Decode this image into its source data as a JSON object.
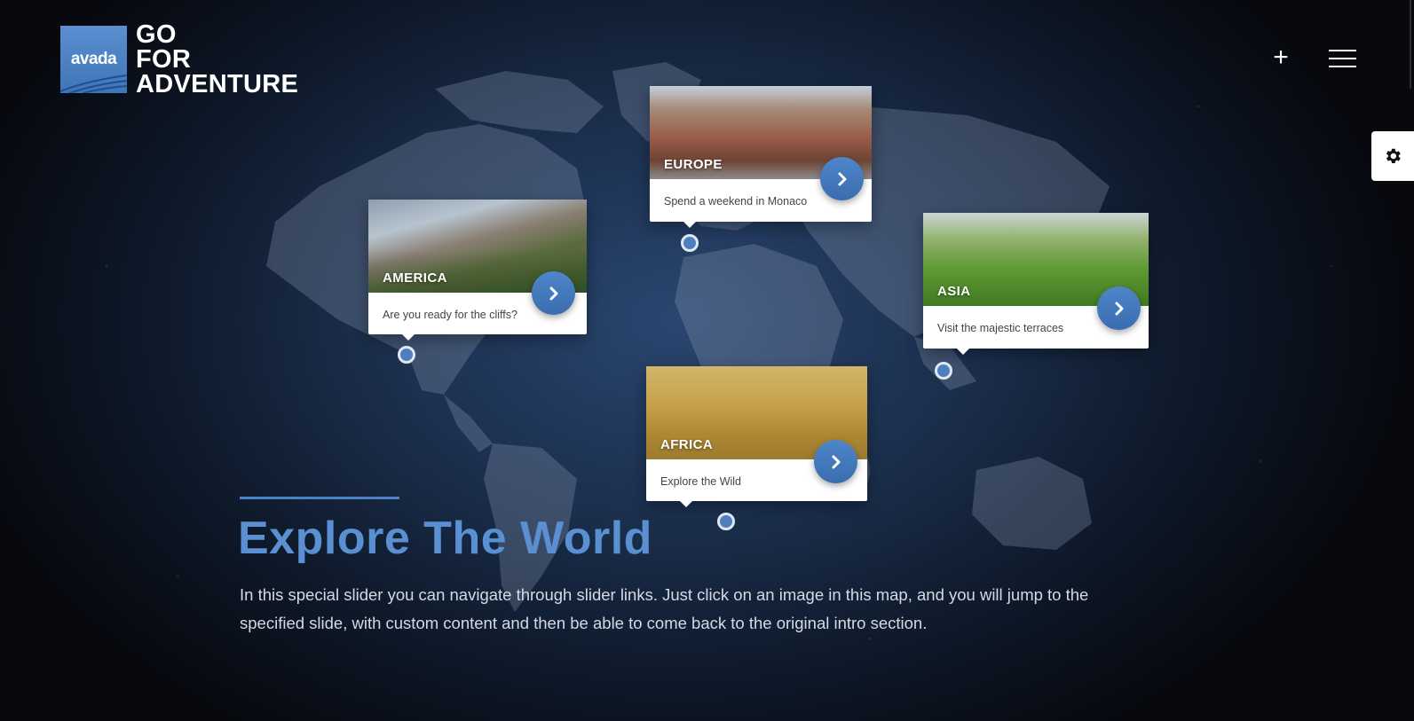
{
  "header": {
    "logo_text": "avada",
    "site_title_lines": [
      "GO",
      "FOR",
      "ADVENTURE"
    ],
    "plus_symbol": "+"
  },
  "cards": {
    "america": {
      "label": "AMERICA",
      "description": "Are you ready for the cliffs?"
    },
    "europe": {
      "label": "EUROPE",
      "description": "Spend a weekend in Monaco"
    },
    "asia": {
      "label": "ASIA",
      "description": "Visit the majestic terraces"
    },
    "africa": {
      "label": "AFRICA",
      "description": "Explore the Wild"
    }
  },
  "intro": {
    "heading": "Explore The World",
    "paragraph": "In this special slider you can navigate through slider links. Just click on an image in this map, and you will jump to the specified slide, with custom content and then be able to come back to the original intro section."
  },
  "colors": {
    "accent": "#4c81c6",
    "heading": "#5a8fd2",
    "background": "#1b2f4d"
  },
  "icons": [
    "plus-icon",
    "hamburger-menu-icon",
    "gear-icon",
    "chevron-right-icon",
    "map-pin-icon"
  ]
}
